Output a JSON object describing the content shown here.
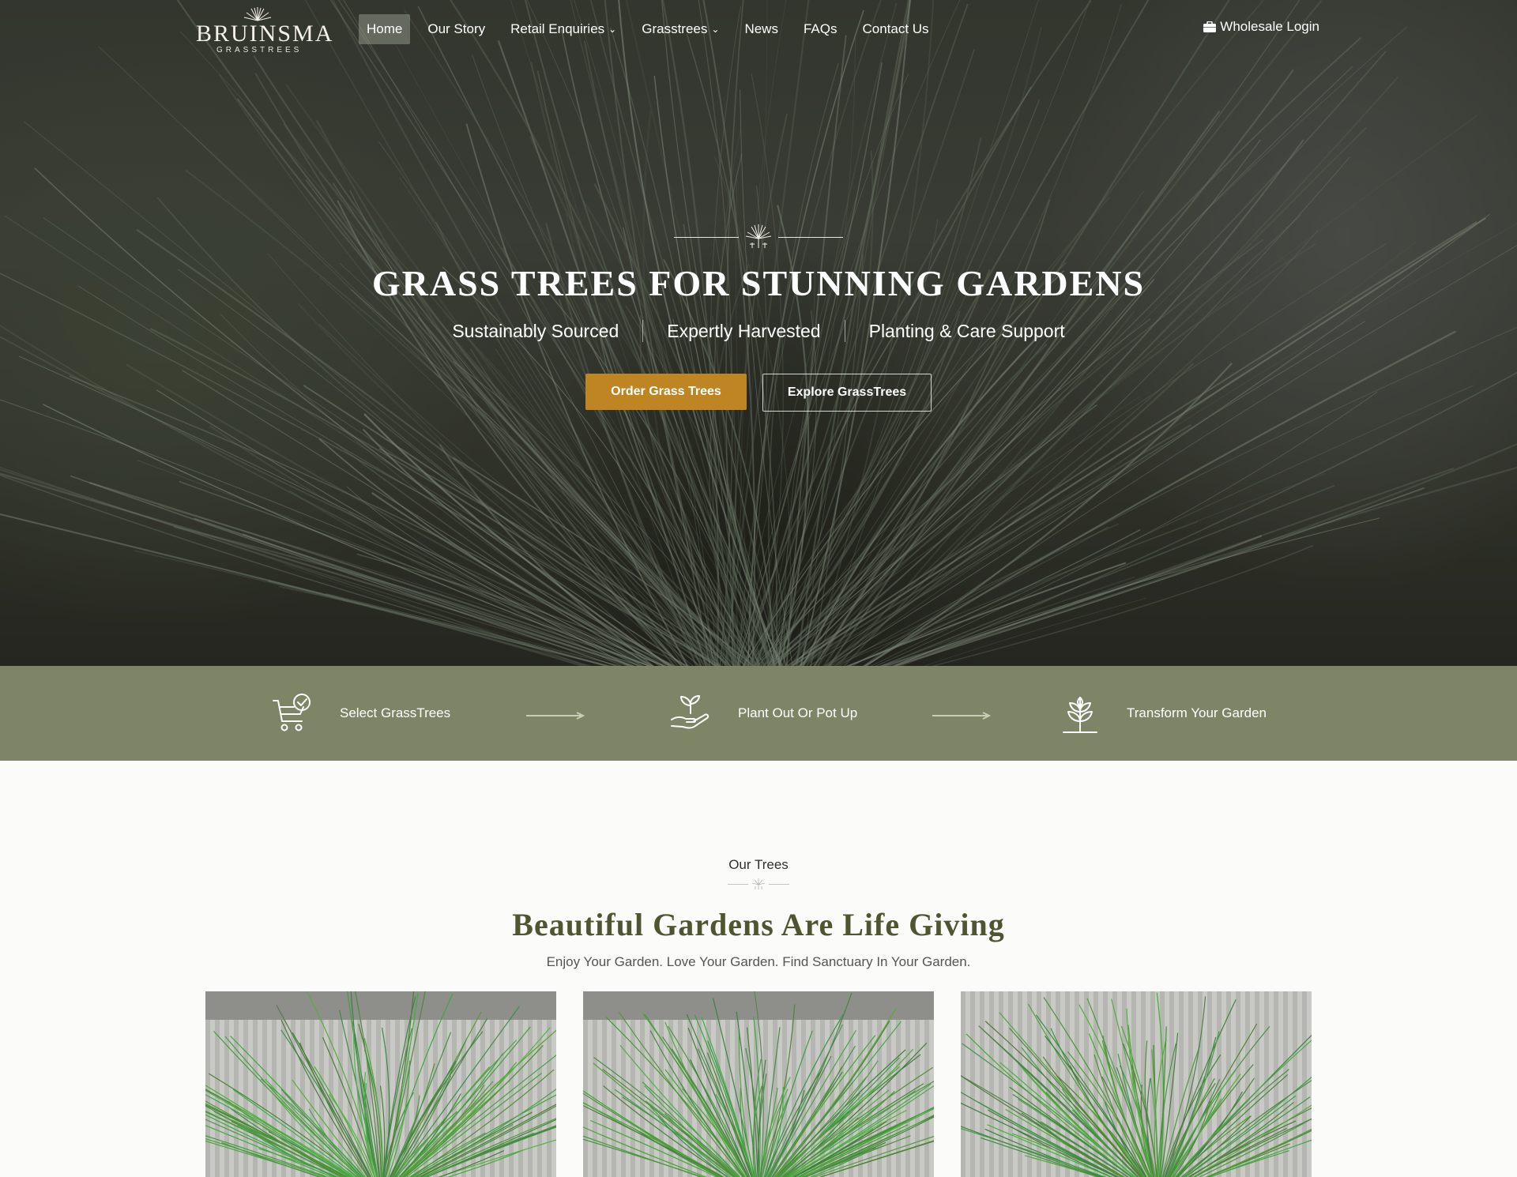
{
  "brand": {
    "name": "BRUINSMA",
    "tagline": "GRASSTREES"
  },
  "nav": {
    "items": [
      {
        "label": "Home",
        "active": true
      },
      {
        "label": "Our Story"
      },
      {
        "label": "Retail Enquiries",
        "dropdown": true
      },
      {
        "label": "Grasstrees",
        "dropdown": true
      },
      {
        "label": "News"
      },
      {
        "label": "FAQs"
      },
      {
        "label": "Contact Us"
      }
    ],
    "login_label": "Wholesale Login",
    "login_icon": "briefcase-icon"
  },
  "hero": {
    "headline": "GRASS TREES FOR STUNNING GARDENS",
    "features": [
      "Sustainably Sourced",
      "Expertly Harvested",
      "Planting & Care Support"
    ],
    "primary_button": "Order Grass Trees",
    "secondary_button": "Explore GrassTrees"
  },
  "steps": [
    {
      "label": "Select GrassTrees",
      "icon": "cart-check-icon"
    },
    {
      "label": "Plant Out Or Pot Up",
      "icon": "hand-seedling-icon"
    },
    {
      "label": "Transform Your Garden",
      "icon": "plant-growth-icon"
    }
  ],
  "trees_section": {
    "eyebrow": "Our Trees",
    "title": "Beautiful Gardens Are Life Giving",
    "subtitle": "Enjoy Your Garden. Love Your Garden. Find Sanctuary In Your Garden."
  },
  "colors": {
    "accent": "#bf8523",
    "steps_band": "#7e8466",
    "title_green": "#4f5530"
  }
}
